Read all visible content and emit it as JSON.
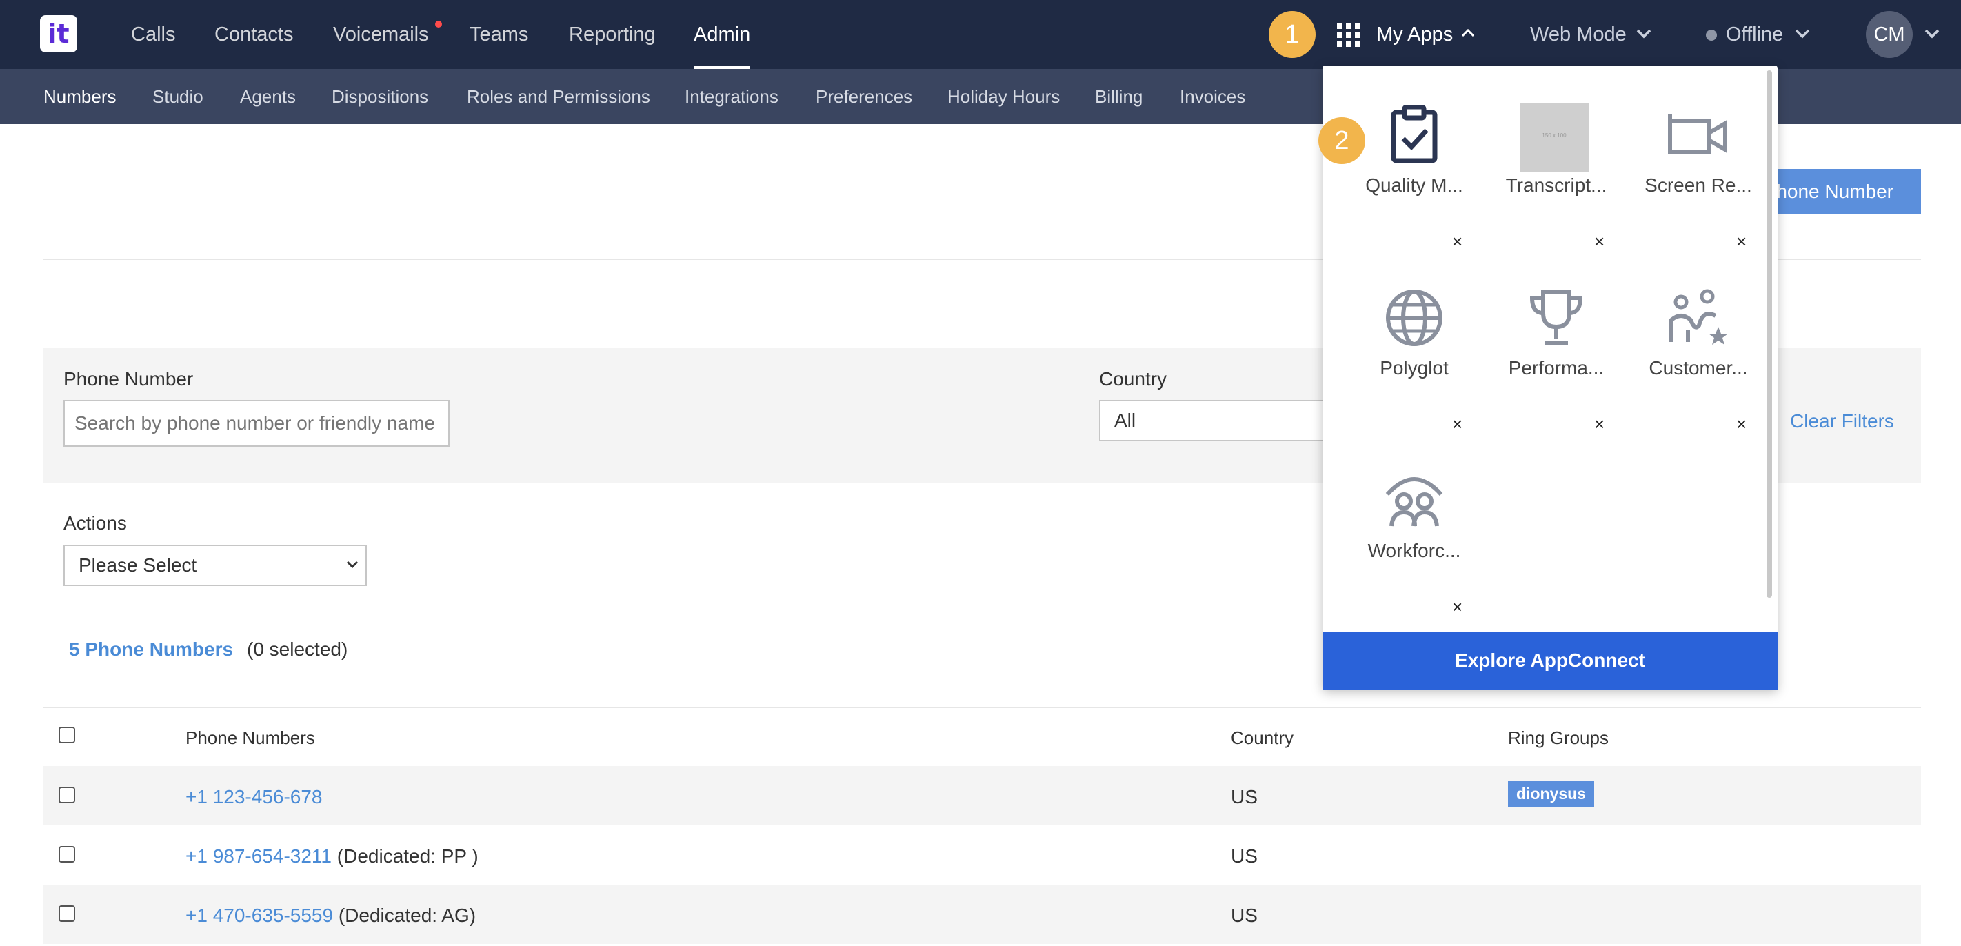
{
  "logo": {
    "glyph": "it"
  },
  "topnav": [
    {
      "label": "Calls"
    },
    {
      "label": "Contacts"
    },
    {
      "label": "Voicemails"
    },
    {
      "label": "Teams"
    },
    {
      "label": "Reporting"
    },
    {
      "label": "Admin",
      "active": true
    }
  ],
  "callouts": {
    "first": "1",
    "second": "2"
  },
  "topbar": {
    "my_apps": "My Apps",
    "web_mode": "Web Mode",
    "status": "Offline",
    "avatar": "CM"
  },
  "subnav": [
    {
      "label": "Numbers",
      "active": true
    },
    {
      "label": "Studio"
    },
    {
      "label": "Agents"
    },
    {
      "label": "Dispositions"
    },
    {
      "label": "Roles and Permissions"
    },
    {
      "label": "Integrations"
    },
    {
      "label": "Preferences"
    },
    {
      "label": "Holiday Hours"
    },
    {
      "label": "Billing"
    },
    {
      "label": "Invoices"
    }
  ],
  "page": {
    "add_button_label": "Phone Number"
  },
  "filters": {
    "phone_label": "Phone Number",
    "phone_placeholder": "Search by phone number or friendly name",
    "country_label": "Country",
    "country_value": "All",
    "clear_filters": "Clear Filters"
  },
  "actions": {
    "label": "Actions",
    "select_value": "Please Select"
  },
  "summary": {
    "count_label": "5 Phone Numbers",
    "selected_label": "(0 selected)"
  },
  "table": {
    "headers": {
      "phone": "Phone Numbers",
      "country": "Country",
      "ring_groups": "Ring Groups"
    },
    "rows": [
      {
        "phone": "+1 123-456-678",
        "note": "",
        "country": "US",
        "ring_group": "dionysus"
      },
      {
        "phone": "+1 987-654-3211",
        "note": "(Dedicated: PP )",
        "country": "US",
        "ring_group": ""
      },
      {
        "phone": "+1 470-635-5559",
        "note": "(Dedicated: AG)",
        "country": "US",
        "ring_group": ""
      }
    ]
  },
  "apps_menu": {
    "apps": [
      {
        "label": "Quality M...",
        "icon": "clipboard-check-icon"
      },
      {
        "label": "Transcript...",
        "icon": "placeholder-image-icon",
        "placeholder_text": "150 x 100"
      },
      {
        "label": "Screen Re...",
        "icon": "video-camera-icon"
      },
      {
        "label": "Polyglot",
        "icon": "globe-icon"
      },
      {
        "label": "Performa...",
        "icon": "trophy-icon"
      },
      {
        "label": "Customer...",
        "icon": "customer-star-icon"
      },
      {
        "label": "Workforc...",
        "icon": "workforce-people-icon"
      }
    ],
    "remove_glyph": "×",
    "explore_label": "Explore AppConnect"
  }
}
